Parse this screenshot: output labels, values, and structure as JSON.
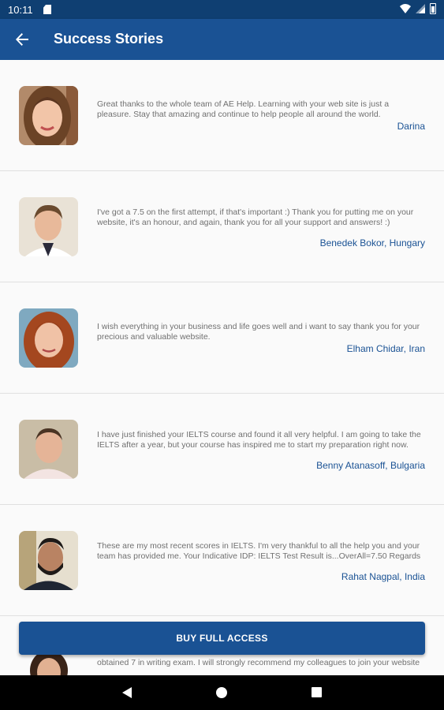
{
  "status_bar": {
    "time": "10:11"
  },
  "app_bar": {
    "title": "Success Stories",
    "back_icon": "arrow-back-icon"
  },
  "stories": [
    {
      "quote": "Great thanks to the whole team of AE Help. Learning with your web site is just a pleasure. Stay that amazing and continue to help people all around the world.",
      "author": "Darina"
    },
    {
      "quote": "I've got a 7.5 on the first attempt, if that's important :) Thank you for putting me on your website, it's an honour, and again, thank you for all your support and answers! :)",
      "author": "Benedek Bokor, Hungary"
    },
    {
      "quote": "I wish everything in your business and life goes well and i want to say thank you for your precious and valuable  website.",
      "author": "Elham Chidar, Iran"
    },
    {
      "quote": "I have just finished your IELTS course and found it all very helpful. I am going to take the IELTS after a year, but your course has inspired me to start my preparation right now.",
      "author": "Benny Atanasoff, Bulgaria"
    },
    {
      "quote": "These are my most recent scores in IELTS. I'm very thankful to all the help you and your team has provided me. Your Indicative IDP: IELTS Test Result is...OverAll=7.50 Regards",
      "author": "Rahat Nagpal, India"
    }
  ],
  "partial_story": {
    "quote": "obtained 7 in writing exam. I will strongly recommend my colleagues to join your website"
  },
  "buy_button": {
    "label": "BUY FULL ACCESS"
  },
  "colors": {
    "primary": "#1a5294",
    "status_bar": "#0f3f72",
    "author_text": "#1a5294"
  }
}
